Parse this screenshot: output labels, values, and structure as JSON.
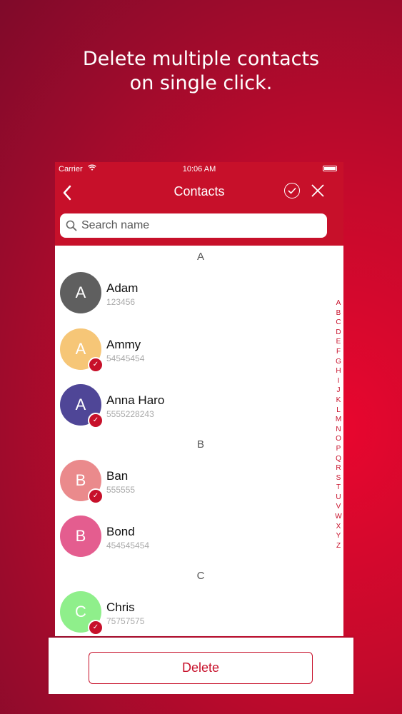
{
  "headline": {
    "line1": "Delete multiple contacts",
    "line2": "on single click."
  },
  "status_bar": {
    "carrier": "Carrier",
    "time": "10:06 AM"
  },
  "nav": {
    "title": "Contacts",
    "back_icon": "chevron-left",
    "confirm_icon": "check-circle",
    "close_icon": "x"
  },
  "search": {
    "placeholder": "Search name",
    "value": ""
  },
  "colors": {
    "accent": "#c7102a"
  },
  "sections": [
    {
      "letter": "A",
      "contacts": [
        {
          "initial": "A",
          "name": "Adam",
          "phone": "123456",
          "color": "#5f5f5f",
          "selected": false
        },
        {
          "initial": "A",
          "name": "Ammy",
          "phone": "54545454",
          "color": "#f6c677",
          "selected": true
        },
        {
          "initial": "A",
          "name": "Anna Haro",
          "phone": "5555228243",
          "color": "#4f4697",
          "selected": true
        }
      ]
    },
    {
      "letter": "B",
      "contacts": [
        {
          "initial": "B",
          "name": "Ban",
          "phone": "555555",
          "color": "#ea8a8c",
          "selected": true
        },
        {
          "initial": "B",
          "name": "Bond",
          "phone": "454545454",
          "color": "#e45d8f",
          "selected": false
        }
      ]
    },
    {
      "letter": "C",
      "contacts": [
        {
          "initial": "C",
          "name": "Chris",
          "phone": "75757575",
          "color": "#8fef8b",
          "selected": true
        }
      ]
    }
  ],
  "alphabet_index": [
    "A",
    "B",
    "C",
    "D",
    "E",
    "F",
    "G",
    "H",
    "I",
    "J",
    "K",
    "L",
    "M",
    "N",
    "O",
    "P",
    "Q",
    "R",
    "S",
    "T",
    "U",
    "V",
    "W",
    "X",
    "Y",
    "Z"
  ],
  "actions": {
    "delete_label": "Delete"
  }
}
